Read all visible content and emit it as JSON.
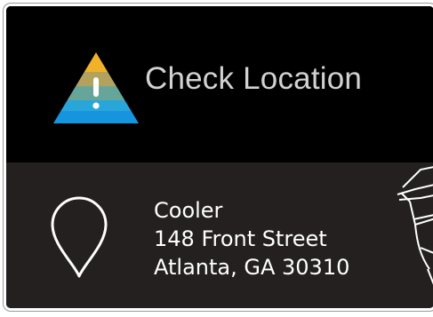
{
  "alert": {
    "title": "Check Location",
    "icon": "warning-triangle-icon"
  },
  "location": {
    "icon": "map-pin-icon",
    "name": "Cooler",
    "street": "148 Front Street",
    "city_state_zip": "Atlanta, GA 30310"
  },
  "colors": {
    "background": "#000000",
    "panel": "#242020",
    "title_text": "#d2d2d2",
    "warning_bands": [
      "#f0b22b",
      "#b3a25e",
      "#66a69a",
      "#28a6da",
      "#1595e0"
    ]
  }
}
